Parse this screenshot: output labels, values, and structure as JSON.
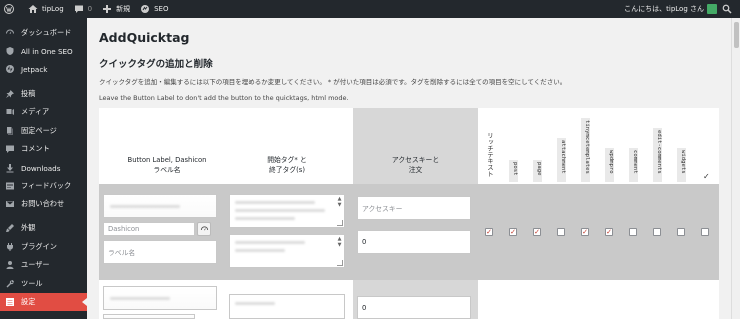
{
  "adminbar": {
    "site_name": "tipLog",
    "comments_count": "0",
    "new_label": "新規",
    "seo_label": "SEO",
    "greeting": "こんにちは、tipLog さん"
  },
  "sidebar": {
    "items": [
      {
        "label": "ダッシュボード",
        "icon": "dashboard-icon"
      },
      {
        "label": "All in One SEO",
        "icon": "seo-icon"
      },
      {
        "label": "Jetpack",
        "icon": "jetpack-icon"
      },
      {
        "label": "投稿",
        "icon": "pin-icon"
      },
      {
        "label": "メディア",
        "icon": "media-icon"
      },
      {
        "label": "固定ページ",
        "icon": "pages-icon"
      },
      {
        "label": "コメント",
        "icon": "comment-icon"
      },
      {
        "label": "Downloads",
        "icon": "download-icon"
      },
      {
        "label": "フィードバック",
        "icon": "feedback-icon"
      },
      {
        "label": "お問い合わせ",
        "icon": "mail-icon"
      },
      {
        "label": "外観",
        "icon": "brush-icon"
      },
      {
        "label": "プラグイン",
        "icon": "plugin-icon"
      },
      {
        "label": "ユーザー",
        "icon": "user-icon"
      },
      {
        "label": "ツール",
        "icon": "wrench-icon"
      },
      {
        "label": "設定",
        "icon": "settings-icon"
      }
    ],
    "current": "設定"
  },
  "page": {
    "title": "AddQuicktag",
    "section_title": "クイックタグの追加と削除",
    "description": "クイックタグを追加・編集するには以下の項目を埋めるか変更してください。 * が付いた項目は必須です。タグを削除するには全ての項目を空にしてください。",
    "description2": "Leave the Button Label to don't add the button to the quicktags, html mode."
  },
  "table": {
    "headers": {
      "col1_line1": "Button Label, Dashicon",
      "col1_line2": "ラベル名",
      "col2_line1": "開始タグ* と",
      "col2_line2": "終了タグ(s)",
      "col3_line1": "アクセスキーと",
      "col3_line2": "注文"
    },
    "checkbox_columns": [
      "リッチテキスト",
      "post",
      "page",
      "attachment",
      "tinymcetemplates",
      "wpdmpro",
      "comment",
      "edit-comments",
      "widgets"
    ],
    "select_all_mark": "✓",
    "row1": {
      "dashicon_placeholder": "Dashicon",
      "label_placeholder": "ラベル名",
      "access_key_placeholder": "アクセスキー",
      "order_value": "0",
      "checked": [
        true,
        true,
        true,
        false,
        true,
        true,
        false,
        false,
        false,
        false
      ]
    },
    "row2": {
      "order_value": "0"
    }
  },
  "colors": {
    "adminbar_bg": "#23282d",
    "menu_current": "#e14d43",
    "checkbox_check": "#c0392b"
  }
}
